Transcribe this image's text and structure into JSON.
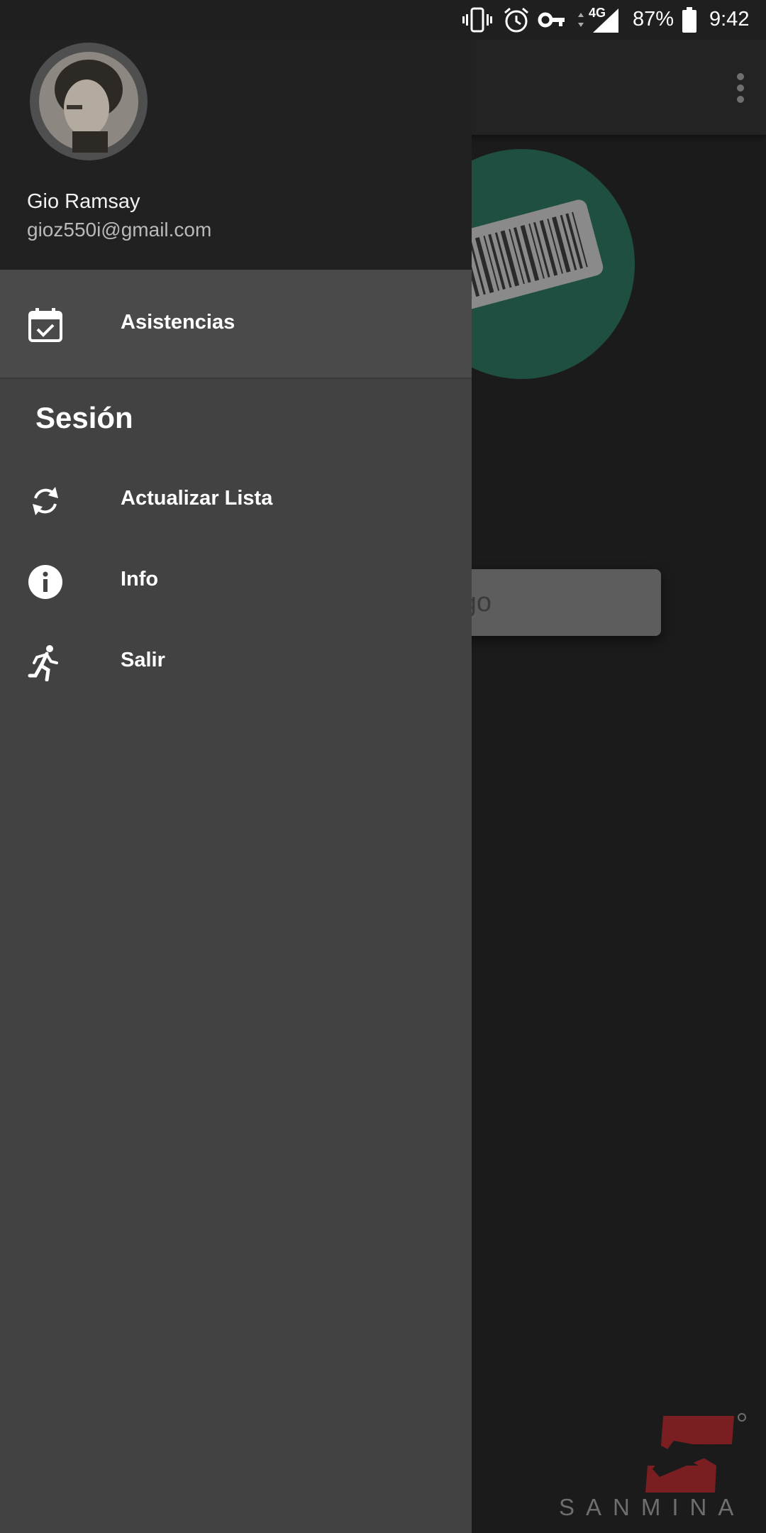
{
  "status_bar": {
    "network": "4G",
    "battery": "87%",
    "time": "9:42",
    "icons": [
      "vibrate-icon",
      "alarm-icon",
      "vpn-key-icon",
      "signal-icon",
      "battery-icon"
    ]
  },
  "drawer": {
    "user": {
      "name": "Gio Ramsay",
      "email": "gioz550i@gmail.com"
    },
    "primary_items": [
      {
        "label": "Asistencias",
        "icon": "calendar-check-icon",
        "selected": true
      }
    ],
    "section_title": "Sesión",
    "session_items": [
      {
        "label": "Actualizar Lista",
        "icon": "refresh-icon"
      },
      {
        "label": "Info",
        "icon": "info-icon"
      },
      {
        "label": "Salir",
        "icon": "run-icon"
      }
    ]
  },
  "background_app": {
    "code_input_placeholder_visible": "odigo",
    "logo_text": "SANMINA",
    "colors": {
      "hero_circle": "#1f4f41",
      "logo_red": "#7a1e22"
    }
  }
}
